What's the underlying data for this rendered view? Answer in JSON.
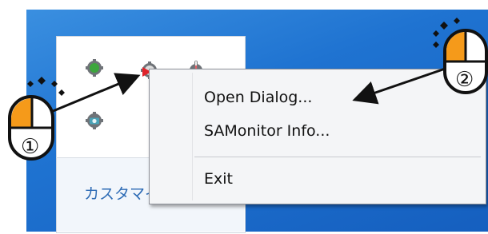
{
  "tray": {
    "customize_link": "カスタマイズ...",
    "icons": [
      "gear-green-icon",
      "gear-red-arrow-icon",
      "gear-thermometer-icon",
      "gear-camera-icon"
    ]
  },
  "context_menu": {
    "items": [
      {
        "label": "Open Dialog..."
      },
      {
        "label": "SAMonitor Info..."
      },
      {
        "label": "Exit"
      }
    ]
  },
  "annotations": {
    "step1_label": "①",
    "step2_label": "②",
    "mouse_highlight_color": "#f59a1a",
    "arrow_color": "#111111"
  },
  "colors": {
    "desktop_blue": "#1f73d1",
    "link_blue": "#2d6bb5"
  }
}
